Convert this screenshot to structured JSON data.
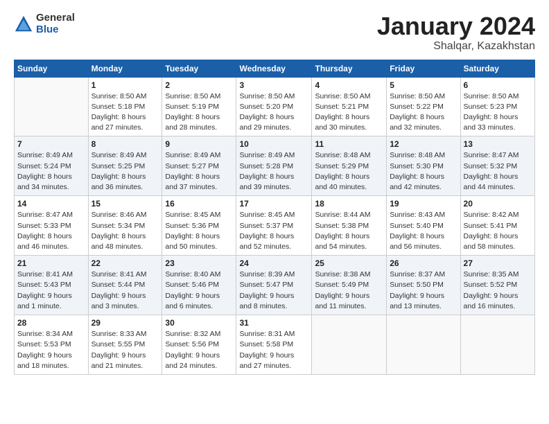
{
  "header": {
    "logo_general": "General",
    "logo_blue": "Blue",
    "title": "January 2024",
    "location": "Shalqar, Kazakhstan"
  },
  "days_of_week": [
    "Sunday",
    "Monday",
    "Tuesday",
    "Wednesday",
    "Thursday",
    "Friday",
    "Saturday"
  ],
  "weeks": [
    [
      {
        "day": "",
        "info": ""
      },
      {
        "day": "1",
        "info": "Sunrise: 8:50 AM\nSunset: 5:18 PM\nDaylight: 8 hours\nand 27 minutes."
      },
      {
        "day": "2",
        "info": "Sunrise: 8:50 AM\nSunset: 5:19 PM\nDaylight: 8 hours\nand 28 minutes."
      },
      {
        "day": "3",
        "info": "Sunrise: 8:50 AM\nSunset: 5:20 PM\nDaylight: 8 hours\nand 29 minutes."
      },
      {
        "day": "4",
        "info": "Sunrise: 8:50 AM\nSunset: 5:21 PM\nDaylight: 8 hours\nand 30 minutes."
      },
      {
        "day": "5",
        "info": "Sunrise: 8:50 AM\nSunset: 5:22 PM\nDaylight: 8 hours\nand 32 minutes."
      },
      {
        "day": "6",
        "info": "Sunrise: 8:50 AM\nSunset: 5:23 PM\nDaylight: 8 hours\nand 33 minutes."
      }
    ],
    [
      {
        "day": "7",
        "info": "Sunrise: 8:49 AM\nSunset: 5:24 PM\nDaylight: 8 hours\nand 34 minutes."
      },
      {
        "day": "8",
        "info": "Sunrise: 8:49 AM\nSunset: 5:25 PM\nDaylight: 8 hours\nand 36 minutes."
      },
      {
        "day": "9",
        "info": "Sunrise: 8:49 AM\nSunset: 5:27 PM\nDaylight: 8 hours\nand 37 minutes."
      },
      {
        "day": "10",
        "info": "Sunrise: 8:49 AM\nSunset: 5:28 PM\nDaylight: 8 hours\nand 39 minutes."
      },
      {
        "day": "11",
        "info": "Sunrise: 8:48 AM\nSunset: 5:29 PM\nDaylight: 8 hours\nand 40 minutes."
      },
      {
        "day": "12",
        "info": "Sunrise: 8:48 AM\nSunset: 5:30 PM\nDaylight: 8 hours\nand 42 minutes."
      },
      {
        "day": "13",
        "info": "Sunrise: 8:47 AM\nSunset: 5:32 PM\nDaylight: 8 hours\nand 44 minutes."
      }
    ],
    [
      {
        "day": "14",
        "info": "Sunrise: 8:47 AM\nSunset: 5:33 PM\nDaylight: 8 hours\nand 46 minutes."
      },
      {
        "day": "15",
        "info": "Sunrise: 8:46 AM\nSunset: 5:34 PM\nDaylight: 8 hours\nand 48 minutes."
      },
      {
        "day": "16",
        "info": "Sunrise: 8:45 AM\nSunset: 5:36 PM\nDaylight: 8 hours\nand 50 minutes."
      },
      {
        "day": "17",
        "info": "Sunrise: 8:45 AM\nSunset: 5:37 PM\nDaylight: 8 hours\nand 52 minutes."
      },
      {
        "day": "18",
        "info": "Sunrise: 8:44 AM\nSunset: 5:38 PM\nDaylight: 8 hours\nand 54 minutes."
      },
      {
        "day": "19",
        "info": "Sunrise: 8:43 AM\nSunset: 5:40 PM\nDaylight: 8 hours\nand 56 minutes."
      },
      {
        "day": "20",
        "info": "Sunrise: 8:42 AM\nSunset: 5:41 PM\nDaylight: 8 hours\nand 58 minutes."
      }
    ],
    [
      {
        "day": "21",
        "info": "Sunrise: 8:41 AM\nSunset: 5:43 PM\nDaylight: 9 hours\nand 1 minute."
      },
      {
        "day": "22",
        "info": "Sunrise: 8:41 AM\nSunset: 5:44 PM\nDaylight: 9 hours\nand 3 minutes."
      },
      {
        "day": "23",
        "info": "Sunrise: 8:40 AM\nSunset: 5:46 PM\nDaylight: 9 hours\nand 6 minutes."
      },
      {
        "day": "24",
        "info": "Sunrise: 8:39 AM\nSunset: 5:47 PM\nDaylight: 9 hours\nand 8 minutes."
      },
      {
        "day": "25",
        "info": "Sunrise: 8:38 AM\nSunset: 5:49 PM\nDaylight: 9 hours\nand 11 minutes."
      },
      {
        "day": "26",
        "info": "Sunrise: 8:37 AM\nSunset: 5:50 PM\nDaylight: 9 hours\nand 13 minutes."
      },
      {
        "day": "27",
        "info": "Sunrise: 8:35 AM\nSunset: 5:52 PM\nDaylight: 9 hours\nand 16 minutes."
      }
    ],
    [
      {
        "day": "28",
        "info": "Sunrise: 8:34 AM\nSunset: 5:53 PM\nDaylight: 9 hours\nand 18 minutes."
      },
      {
        "day": "29",
        "info": "Sunrise: 8:33 AM\nSunset: 5:55 PM\nDaylight: 9 hours\nand 21 minutes."
      },
      {
        "day": "30",
        "info": "Sunrise: 8:32 AM\nSunset: 5:56 PM\nDaylight: 9 hours\nand 24 minutes."
      },
      {
        "day": "31",
        "info": "Sunrise: 8:31 AM\nSunset: 5:58 PM\nDaylight: 9 hours\nand 27 minutes."
      },
      {
        "day": "",
        "info": ""
      },
      {
        "day": "",
        "info": ""
      },
      {
        "day": "",
        "info": ""
      }
    ]
  ]
}
